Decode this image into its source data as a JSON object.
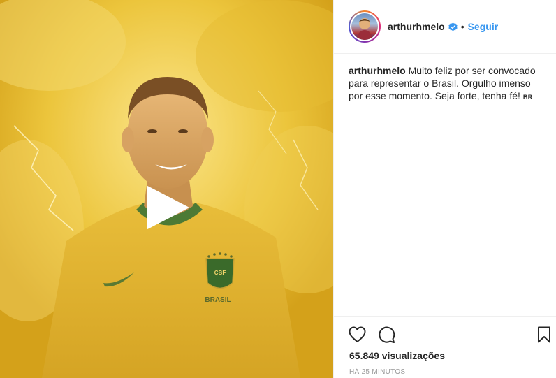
{
  "post": {
    "media_type": "video",
    "media_alt": "Jogador com a camisa amarela da seleção brasileira",
    "shirt_crest": "CBF",
    "shirt_text": "BRASIL"
  },
  "header": {
    "username": "arthurhmelo",
    "separator": "•",
    "follow_label": "Seguir"
  },
  "caption": {
    "username": "arthurhmelo",
    "text": "Muito feliz por ser convocado para representar o Brasil. Orgulho imenso por esse momento. Seja forte, tenha fé!",
    "flag": "BR"
  },
  "stats": {
    "views": "65.849 visualizações",
    "timestamp": "HÁ 25 MINUTOS"
  },
  "icons": {
    "like": "heart-icon",
    "comment": "comment-icon",
    "save": "bookmark-icon",
    "play": "play-icon",
    "verified": "verified-badge-icon"
  },
  "colors": {
    "accent": "#3897f0",
    "border": "#efefef",
    "text": "#262626",
    "muted": "#999999"
  }
}
